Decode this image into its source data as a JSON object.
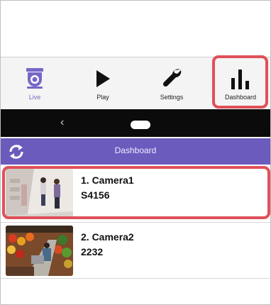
{
  "nav": {
    "items": [
      {
        "label": "Live",
        "icon": "camera-dome-icon"
      },
      {
        "label": "Play",
        "icon": "play-icon"
      },
      {
        "label": "Settings",
        "icon": "wrench-icon"
      },
      {
        "label": "Dashboard",
        "icon": "bar-chart-icon"
      }
    ],
    "active_color": "#7866c9"
  },
  "system_bar": {
    "back_glyph": "‹"
  },
  "header": {
    "title": "Dashboard",
    "refresh_icon": "refresh-icon",
    "color": "#6a5bbd"
  },
  "cameras": [
    {
      "title": "1. Camera1",
      "code": "S4156"
    },
    {
      "title": "2. Camera2",
      "code": "2232"
    }
  ],
  "highlight_color": "#e0505a"
}
